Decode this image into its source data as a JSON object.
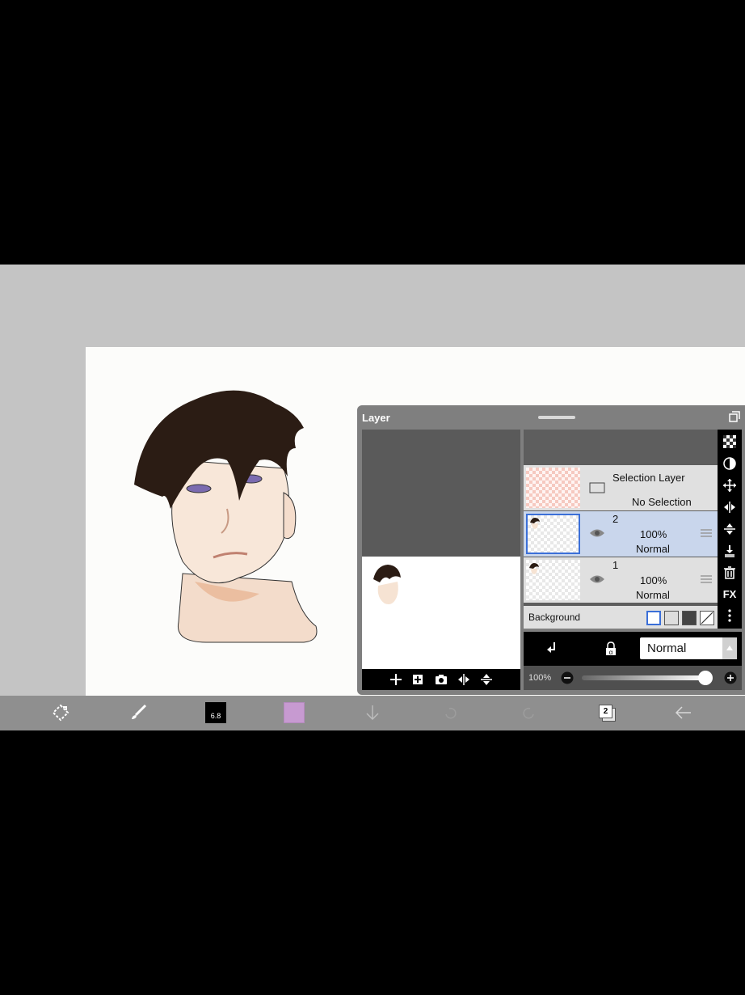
{
  "layer_panel": {
    "title": "Layer",
    "selection_layer": {
      "name": "Selection Layer",
      "status": "No Selection"
    },
    "layers": [
      {
        "number": "2",
        "opacity": "100%",
        "blend": "Normal",
        "selected": true
      },
      {
        "number": "1",
        "opacity": "100%",
        "blend": "Normal",
        "selected": false
      }
    ],
    "background": {
      "label": "Background"
    },
    "blend_mode": {
      "value": "Normal"
    },
    "opacity": {
      "label": "100%",
      "value": 1.0
    },
    "side_fx_label": "FX"
  },
  "toolbar": {
    "brush_size": "6.8",
    "color_swatch": "#c79ad1",
    "layer_count": "2"
  },
  "colors": {
    "hair": "#2b1c14",
    "skin": "#f6e3d3",
    "eye": "#7b6bb0",
    "selection_blue": "#3b6fd8"
  }
}
